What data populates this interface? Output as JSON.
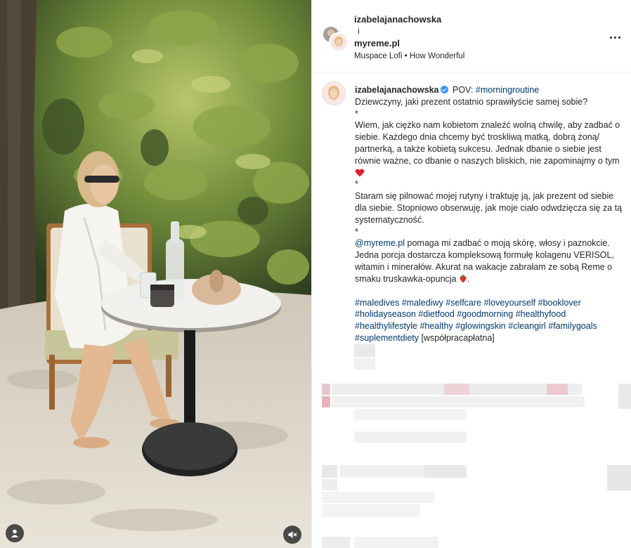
{
  "header": {
    "username_1": "izabelajanachowska",
    "conjunction": "i",
    "username_2": "myreme.pl",
    "audio_artist": "Muspace Lofi",
    "audio_separator": "•",
    "audio_title": "How Wonderful",
    "more_options_icon": "more-horizontal-icon"
  },
  "caption": {
    "username": "izabelajanachowska",
    "intro_text": "POV:",
    "intro_hashtag": "#morningroutine",
    "line1": "Dziewczyny, jaki prezent ostatnio sprawiłyście samej sobie?",
    "sep1": "*",
    "para1": "Wiem, jak ciężko nam kobietom znaleźć wolną chwilę, aby zadbać o siebie. Każdego dnia chcemy być troskliwą matką, dobrą żoną/ partnerką, a także kobietą sukcesu. Jednak dbanie o siebie jest równie ważne, co dbanie o naszych bliskich, nie zapominajmy o tym",
    "sep2": "*",
    "para2": "Staram się pilnować mojej rutyny i traktuję ją, jak prezent od siebie dla siebie. Stopniowo obserwuję, jak moje ciało odwdzięcza się za tą systematyczność.",
    "sep3": "*",
    "mention": "@myreme.pl",
    "para3": "pomaga mi zadbać o moją skórę, włosy i paznokcie. Jedna porcja dostarcza kompleksową formułę kolagenu VERISOL, witamin i minerałów. Akurat na wakacje zabrałam ze sobą Reme o smaku truskawka-opuncja",
    "para3_end": ".",
    "hashtags": [
      "#maledives",
      "#malediwy",
      "#selfcare",
      "#loveyourself",
      "#booklover",
      "#holidayseason",
      "#dietfood",
      "#goodmorning",
      "#healthyfood",
      "#healthylifestyle",
      "#healthy",
      "#glowingskin",
      "#cleangirl",
      "#familygoals",
      "#suplementdiety"
    ],
    "paid_label": "[współpracapłatna]"
  },
  "media": {
    "user_tag_icon": "user-icon",
    "mute_icon": "speaker-muted-icon"
  },
  "colors": {
    "link": "#00376b",
    "verified": "#3897f0",
    "text": "#262626"
  }
}
